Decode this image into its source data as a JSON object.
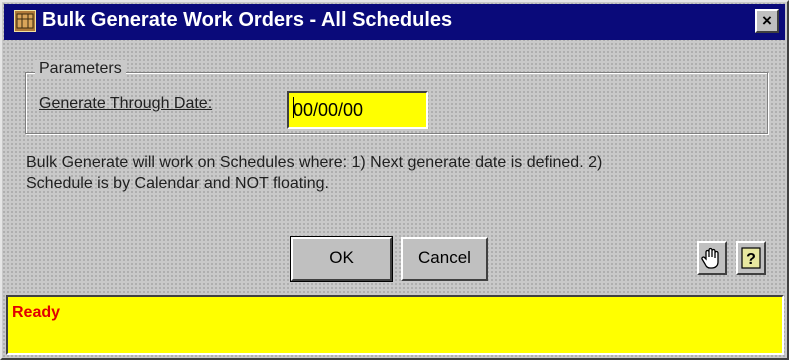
{
  "window": {
    "title": "Bulk Generate Work Orders - All Schedules",
    "close_label": "×"
  },
  "parameters": {
    "group_label": "Parameters",
    "date_label": "Generate Through Date:",
    "date_value": "00/00/00"
  },
  "info": {
    "line1": "Bulk Generate will work on Schedules where: 1) Next generate date is defined. 2)",
    "line2": "Schedule is by Calendar and NOT floating."
  },
  "buttons": {
    "ok_label": "OK",
    "cancel_label": "Cancel"
  },
  "icons": {
    "app": "work-orders-icon",
    "hand": "hand-stop-icon",
    "help": "help-question-icon"
  },
  "status": {
    "text": "Ready"
  },
  "colors": {
    "titlebar": "#0a0a7a",
    "input_bg": "#ffff00",
    "status_bg": "#ffff00",
    "status_text": "#e00000"
  }
}
